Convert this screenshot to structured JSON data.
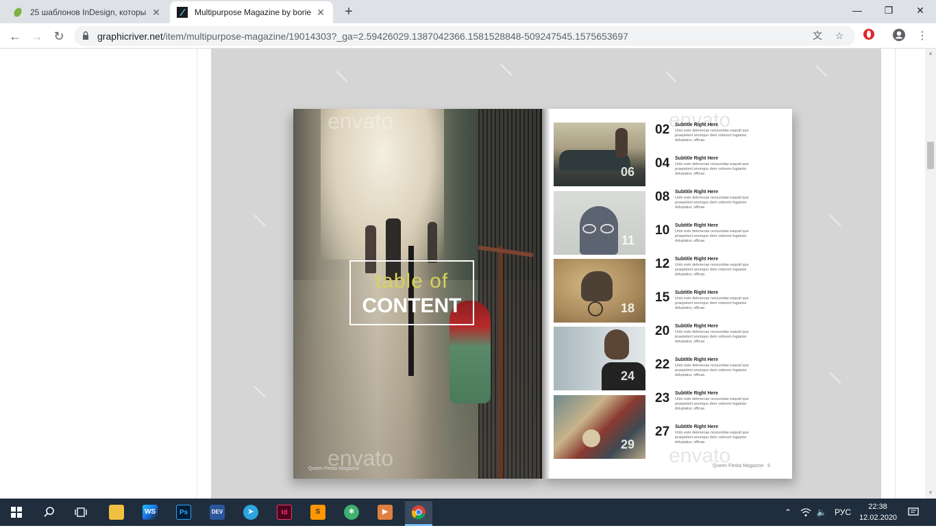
{
  "browser": {
    "tabs": [
      {
        "title": "25 шаблонов InDesign, которы",
        "active": false
      },
      {
        "title": "Multipurpose Magazine by borie",
        "active": true
      }
    ],
    "url_host": "graphicriver.net",
    "url_path": "/item/multipurpose-magazine/19014303?_ga=2.59426029.1387042366.1581528848-509247545.1575653697"
  },
  "magazine": {
    "left_page": {
      "title_small": "table of",
      "title_big": "CONTENT",
      "watermark": "envato",
      "footer": "Queen Fiesta Magazine"
    },
    "right_page": {
      "watermark": "envato",
      "footer": "Queen Fiesta Magazine",
      "page_number": "5",
      "photos": [
        {
          "num": "06",
          "subject": "woman-on-car"
        },
        {
          "num": "11",
          "subject": "cat-with-glasses"
        },
        {
          "num": "18",
          "subject": "elephant-on-bicycle"
        },
        {
          "num": "24",
          "subject": "bearded-man"
        },
        {
          "num": "29",
          "subject": "collage"
        }
      ],
      "entries": [
        {
          "num": "02",
          "subtitle": "Subtitle Right Here",
          "text": "Unto este delenecae nossundae eaquid que praepelent arumquo dem volorem fugianisi doluptatur, officae."
        },
        {
          "num": "04",
          "subtitle": "Subtitle Right Here",
          "text": "Unto este delenecae nossundae eaquid que praepelent arumquo dem volorem fugianisi doluptatur, officae."
        },
        {
          "num": "08",
          "subtitle": "Subtitle Right Here",
          "text": "Unto este delenecae nossundae eaquid que praepelent arumquo dem volorem fugianisi doluptatur, officae."
        },
        {
          "num": "10",
          "subtitle": "Subtitle Right Here",
          "text": "Unto este delenecae nossundae eaquid que praepelent arumquo dem volorem fugianisi doluptatur, officae."
        },
        {
          "num": "12",
          "subtitle": "Subtitle Right Here",
          "text": "Unto este delenecae nossundae eaquid que praepelent arumquo dem volorem fugianisi doluptatur, officae."
        },
        {
          "num": "15",
          "subtitle": "Subtitle Right Here",
          "text": "Unto este delenecae nossundae eaquid que praepelent arumquo dem volorem fugianisi doluptatur, officae."
        },
        {
          "num": "20",
          "subtitle": "Subtitle Right Here",
          "text": "Unto este delenecae nossundae eaquid que praepelent arumquo dem volorem fugianisi doluptatur, officae."
        },
        {
          "num": "22",
          "subtitle": "Subtitle Right Here",
          "text": "Unto este delenecae nossundae eaquid que praepelent arumquo dem volorem fugianisi doluptatur, officae."
        },
        {
          "num": "23",
          "subtitle": "Subtitle Right Here",
          "text": "Unto este delenecae nossundae eaquid que praepelent arumquo dem volorem fugianisi doluptatur, officae."
        },
        {
          "num": "27",
          "subtitle": "Subtitle Right Here",
          "text": "Unto este delenecae nossundae eaquid que praepelent arumquo dem volorem fugianisi doluptatur, officae."
        }
      ]
    }
  },
  "taskbar": {
    "apps": [
      {
        "name": "file-explorer",
        "label": "",
        "color": "#f0c040"
      },
      {
        "name": "webstorm",
        "label": "WS",
        "color": "#1a73e8"
      },
      {
        "name": "photoshop",
        "label": "Ps",
        "color": "#001e36"
      },
      {
        "name": "devexpress",
        "label": "DEV",
        "color": "#2b579a"
      },
      {
        "name": "telegram",
        "label": "",
        "color": "#2ca5e0"
      },
      {
        "name": "indesign",
        "label": "Id",
        "color": "#49021f"
      },
      {
        "name": "sublime-text",
        "label": "S",
        "color": "#ff9800"
      },
      {
        "name": "atom",
        "label": "",
        "color": "#40b070"
      },
      {
        "name": "media-player",
        "label": "",
        "color": "#e08040"
      },
      {
        "name": "chrome",
        "label": "",
        "color": "#4285f4"
      }
    ],
    "language": "РУС",
    "time": "22:38",
    "date": "12.02.2020"
  }
}
